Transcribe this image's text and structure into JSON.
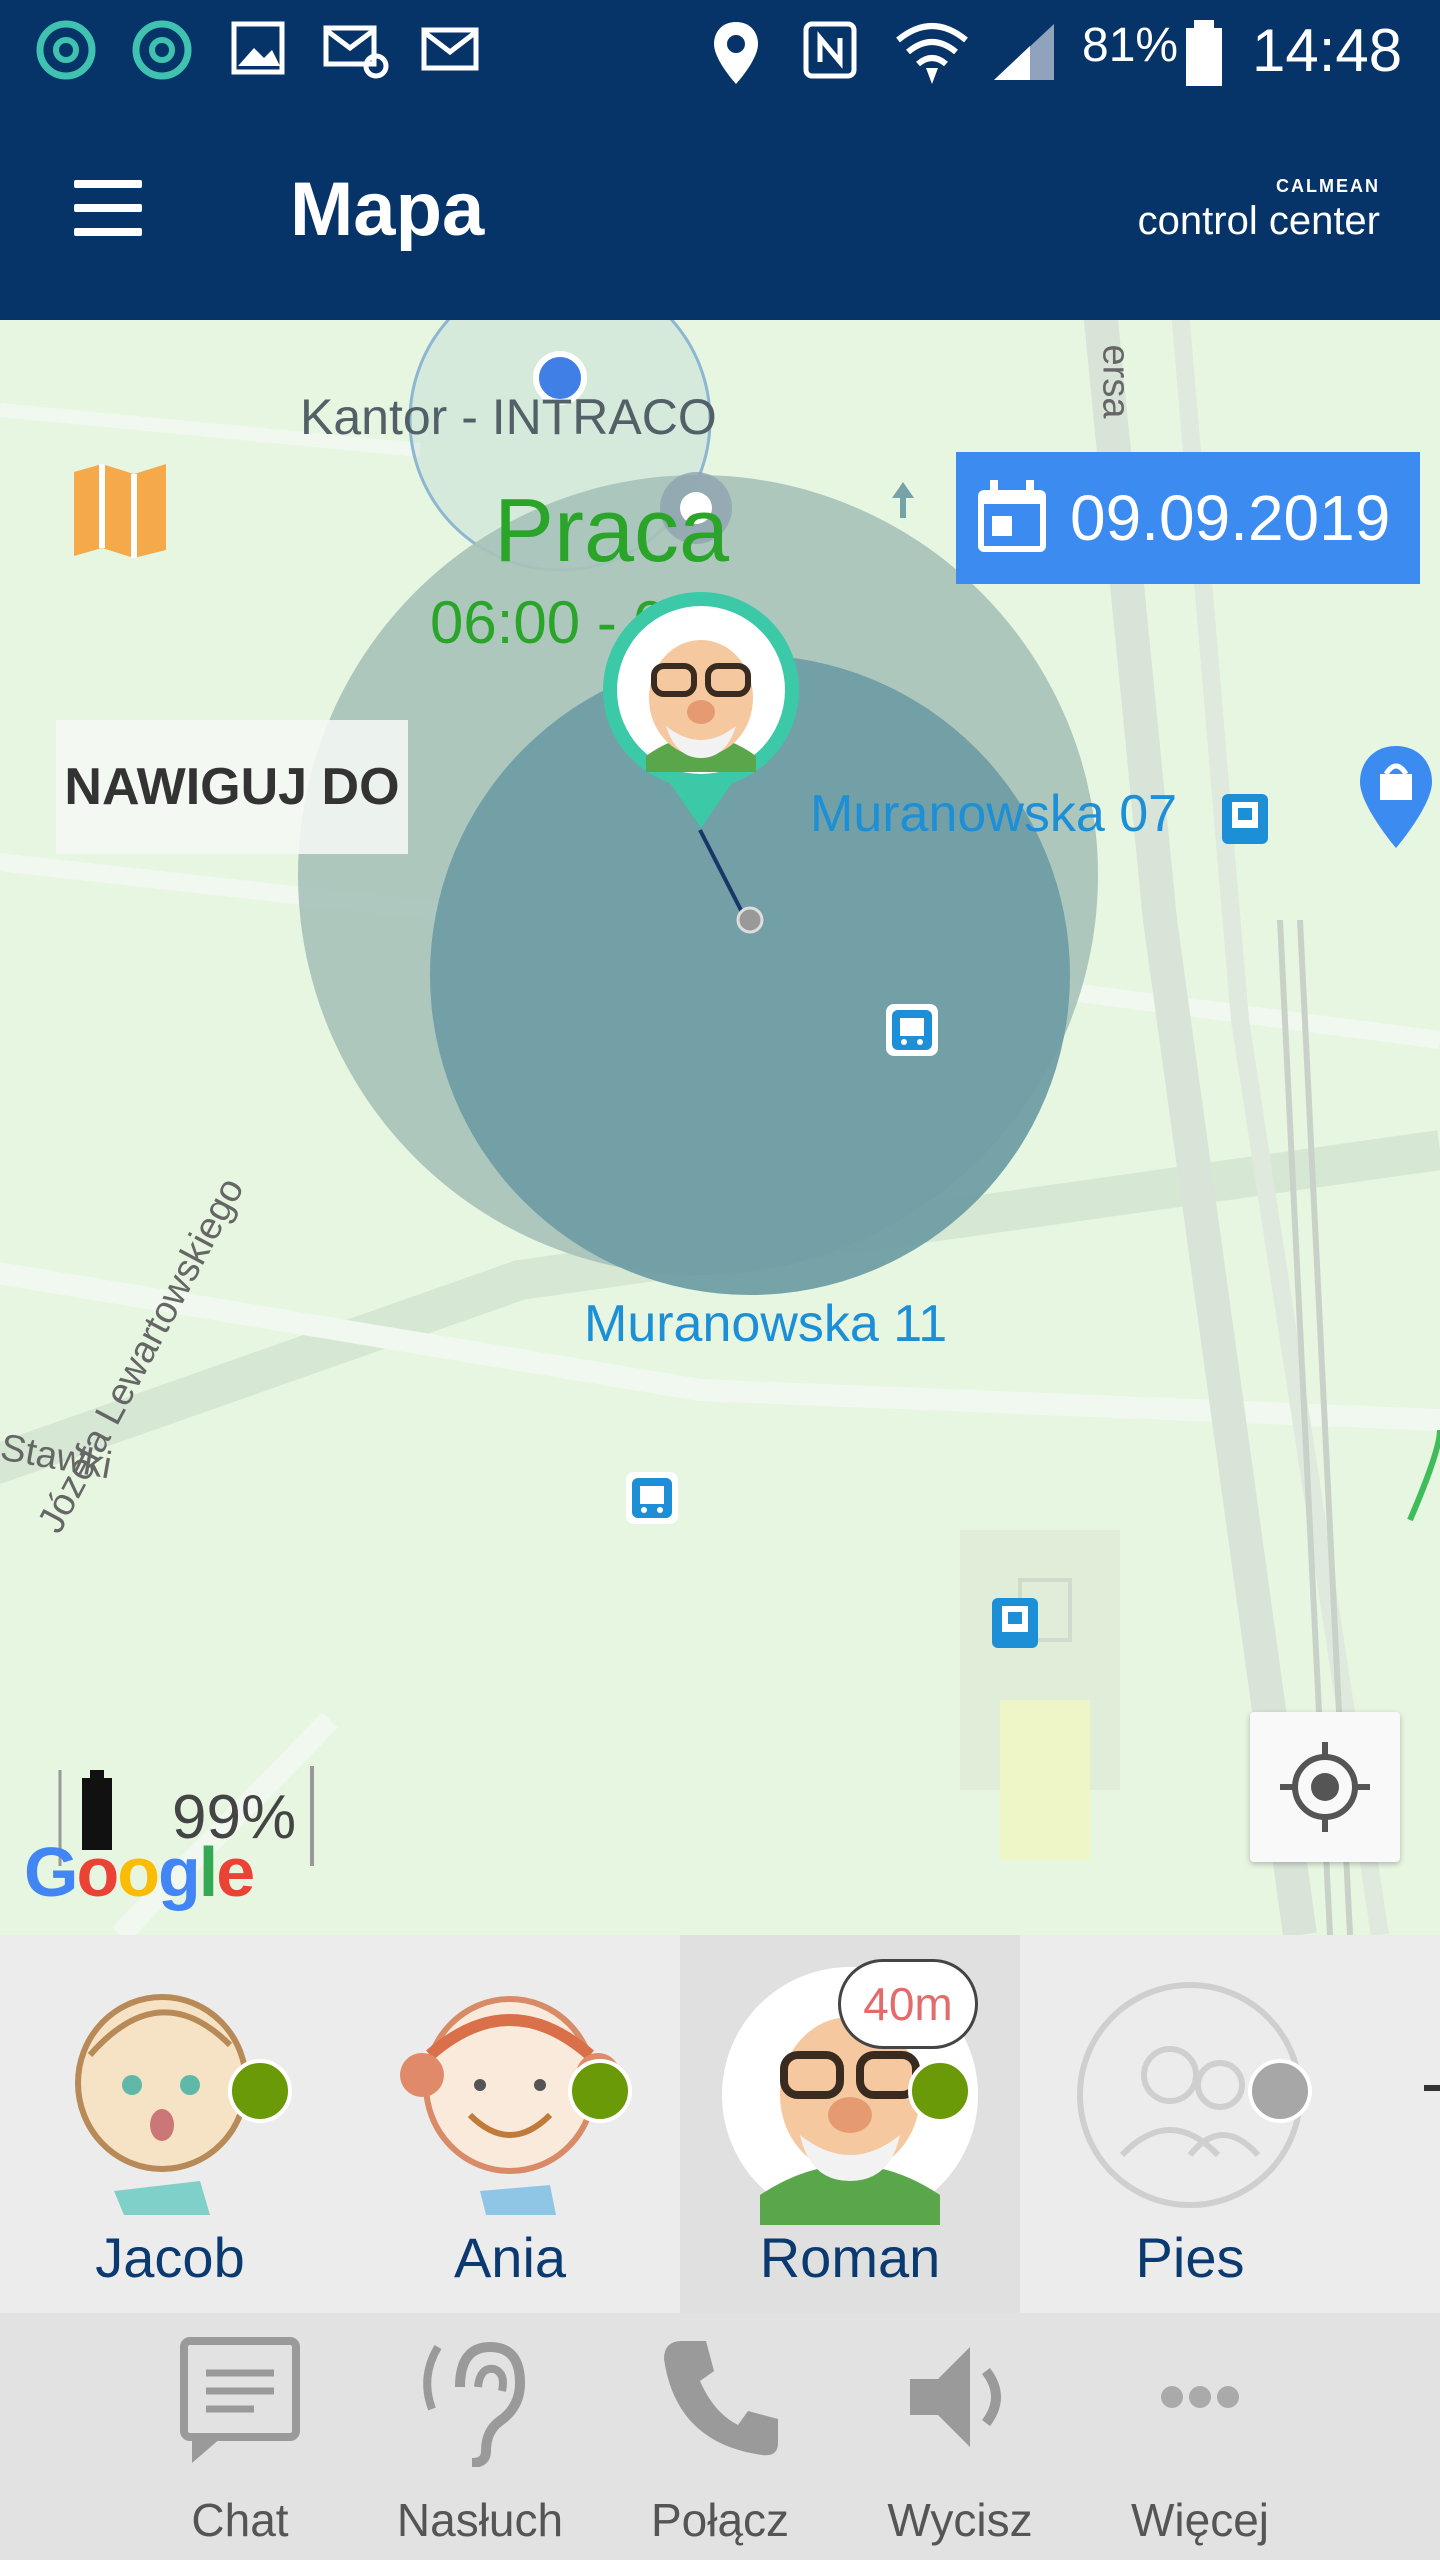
{
  "status_bar": {
    "battery": "81%",
    "time": "14:48"
  },
  "app_bar": {
    "title": "Mapa",
    "brand_small": "CALMEAN",
    "brand_big": "control center"
  },
  "map": {
    "date_label": "09.09.2019",
    "navigate_label": "NAWIGUJ DO",
    "poi_label": "Kantor - INTRACO",
    "geofence_name": "Praca",
    "geofence_time": "06:00 - 0",
    "geofence_time_hidden": "0:00",
    "stop_labels": [
      "Muranowska 07",
      "Muranowska 11"
    ],
    "streets": [
      "Stawki",
      "Józefa Lewartowskiego",
      "ersa"
    ],
    "device_battery": "99%",
    "google_logo": "Google",
    "geofence_color": "#2aa52a",
    "accent_color": "#3c8bf0"
  },
  "profiles": [
    {
      "name": "Jacob",
      "status": "online",
      "selected": false
    },
    {
      "name": "Ania",
      "status": "online",
      "selected": false
    },
    {
      "name": "Roman",
      "status": "online",
      "selected": true,
      "distance": "40m"
    },
    {
      "name": "Pies",
      "status": "offline",
      "selected": false
    }
  ],
  "actions": [
    {
      "label": "Chat",
      "icon": "chat-icon"
    },
    {
      "label": "Nasłuch",
      "icon": "ear-icon"
    },
    {
      "label": "Połącz",
      "icon": "phone-icon"
    },
    {
      "label": "Wycisz",
      "icon": "speaker-icon"
    },
    {
      "label": "Więcej",
      "icon": "more-icon"
    }
  ]
}
